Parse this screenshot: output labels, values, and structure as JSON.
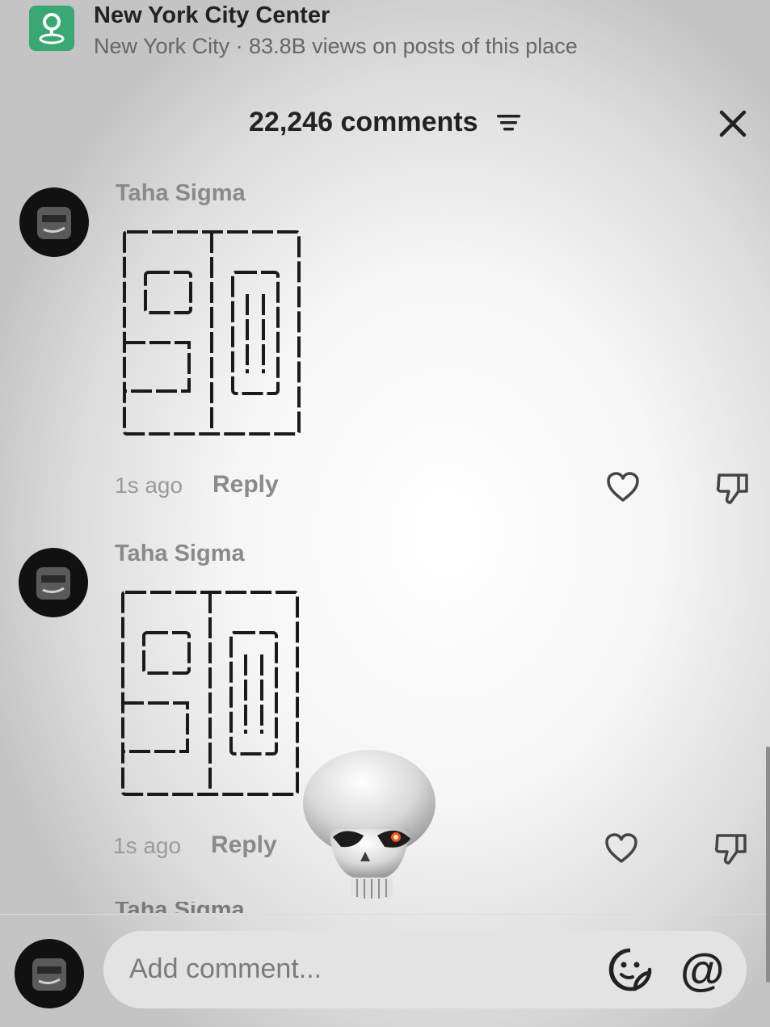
{
  "location": {
    "title": "New York City Center",
    "subtitle": "New York City · 83.8B views on posts of this place",
    "icon": "location-pin-icon",
    "icon_color": "#3aa872"
  },
  "header": {
    "title": "22,246 comments",
    "filter_icon": "filter-icon",
    "close_icon": "close-icon"
  },
  "comments": [
    {
      "user": "Taha Sigma",
      "time": "1s ago",
      "reply_label": "Reply"
    },
    {
      "user": "Taha Sigma",
      "time": "1s ago",
      "reply_label": "Reply"
    }
  ],
  "peek_comment_user": "Taha Sigma",
  "input": {
    "placeholder": "Add comment...",
    "at_label": "@"
  },
  "overlay": {
    "sticker": "skull-emoji"
  }
}
